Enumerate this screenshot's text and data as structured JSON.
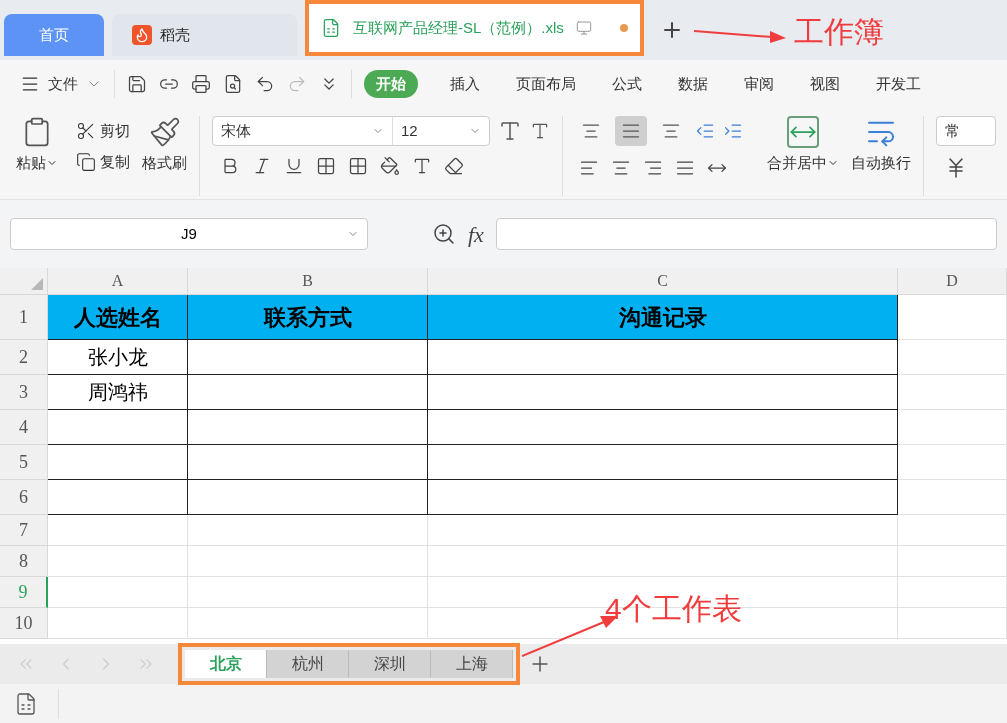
{
  "doc_tabs": [
    {
      "label": "首页",
      "kind": "home",
      "selected": false
    },
    {
      "label": "稻壳",
      "kind": "docer",
      "selected": false
    },
    {
      "label": "互联网产品经理-SL（范例）.xls",
      "kind": "sheet",
      "selected": true,
      "modified": true
    }
  ],
  "annotations": [
    {
      "label": "工作簿"
    },
    {
      "label": "4个工作表"
    }
  ],
  "menu": {
    "file": "文件",
    "tabs": [
      {
        "label": "开始",
        "selected": true
      },
      {
        "label": "插入",
        "selected": false
      },
      {
        "label": "页面布局",
        "selected": false
      },
      {
        "label": "公式",
        "selected": false
      },
      {
        "label": "数据",
        "selected": false
      },
      {
        "label": "审阅",
        "selected": false
      },
      {
        "label": "视图",
        "selected": false
      },
      {
        "label": "开发工",
        "selected": false
      }
    ]
  },
  "toolbar": {
    "paste": "粘贴",
    "cut": "剪切",
    "copy": "复制",
    "format_painter": "格式刷",
    "font": "宋体",
    "font_size": "12",
    "merge": "合并居中",
    "wrap": "自动换行",
    "number_format": "常",
    "vertical_align": [
      {
        "kind": "top",
        "selected": false
      },
      {
        "kind": "middle",
        "selected": true
      },
      {
        "kind": "bottom",
        "selected": false
      }
    ]
  },
  "formula_bar": {
    "cell": "J9",
    "formula_label": "fx"
  },
  "grid": {
    "columns": [
      "A",
      "B",
      "C",
      "D"
    ],
    "rows": [
      {
        "number": "1",
        "selected": false,
        "cells": [
          "人选姓名",
          "联系方式",
          "沟通记录",
          ""
        ]
      },
      {
        "number": "2",
        "selected": false,
        "cells": [
          "张小龙",
          "",
          "",
          ""
        ]
      },
      {
        "number": "3",
        "selected": false,
        "cells": [
          "周鸿祎",
          "",
          "",
          ""
        ]
      },
      {
        "number": "4",
        "selected": false,
        "cells": [
          "",
          "",
          "",
          ""
        ]
      },
      {
        "number": "5",
        "selected": false,
        "cells": [
          "",
          "",
          "",
          ""
        ]
      },
      {
        "number": "6",
        "selected": false,
        "cells": [
          "",
          "",
          "",
          ""
        ]
      },
      {
        "number": "7",
        "selected": false,
        "cells": [
          "",
          "",
          "",
          ""
        ]
      },
      {
        "number": "8",
        "selected": false,
        "cells": [
          "",
          "",
          "",
          ""
        ]
      },
      {
        "number": "9",
        "selected": true,
        "cells": [
          "",
          "",
          "",
          ""
        ]
      },
      {
        "number": "10",
        "selected": false,
        "cells": [
          "",
          "",
          "",
          ""
        ]
      }
    ]
  },
  "sheets": [
    {
      "label": "北京",
      "selected": true
    },
    {
      "label": "杭州",
      "selected": false
    },
    {
      "label": "深圳",
      "selected": false
    },
    {
      "label": "上海",
      "selected": false
    }
  ]
}
